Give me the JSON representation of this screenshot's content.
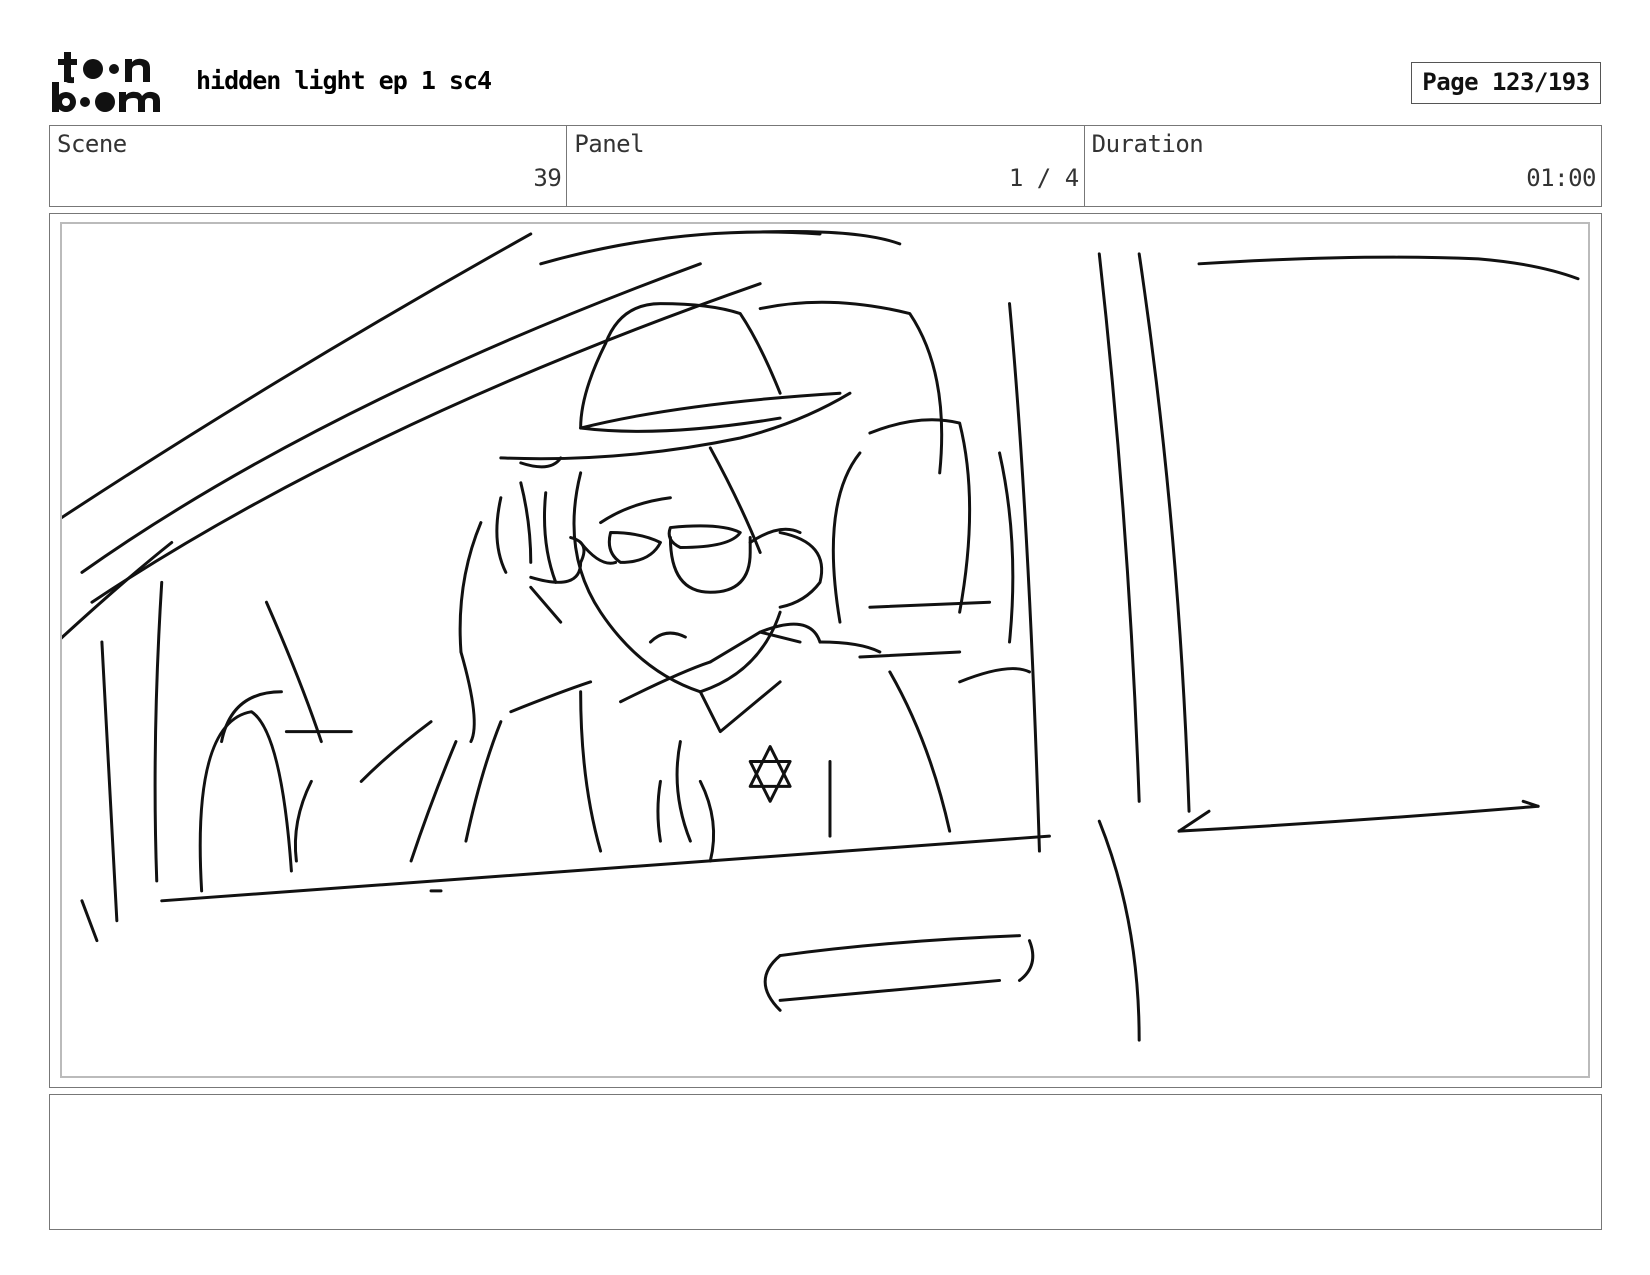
{
  "header": {
    "brand": "toon boom",
    "title": "hidden light ep 1 sc4",
    "page_label": "Page 123/193"
  },
  "info": {
    "scene": {
      "label": "Scene",
      "value": "39"
    },
    "panel": {
      "label": "Panel",
      "value": "1 / 4"
    },
    "duration": {
      "label": "Duration",
      "value": "01:00"
    }
  },
  "notes": {
    "text": ""
  },
  "colors": {
    "ink": "#111111",
    "frame": "#777777",
    "inner_frame": "#bbbbbb"
  },
  "icons": {
    "logo": "toon-boom-logo-icon"
  }
}
